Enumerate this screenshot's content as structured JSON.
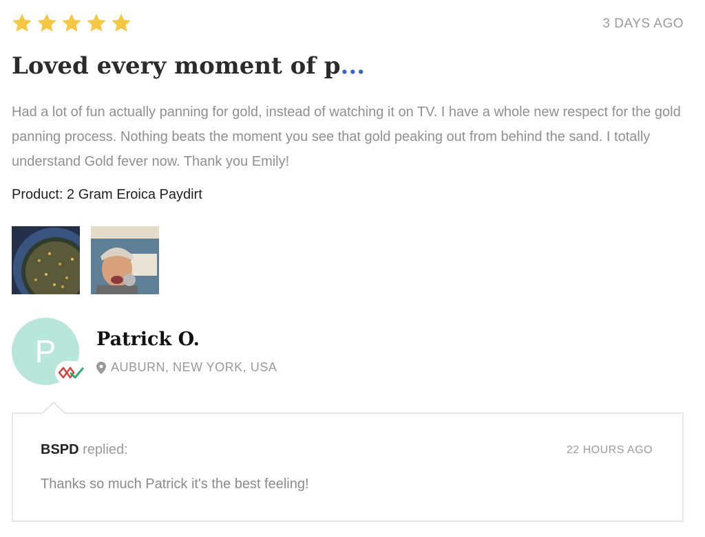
{
  "review": {
    "rating": 5,
    "max_rating": 5,
    "date": "3 DAYS AGO",
    "title": "Loved every moment of p",
    "title_ellipsis": "...",
    "body": "Had a lot of fun actually panning for gold, instead of watching it on TV. I have a whole new respect for the gold panning process. Nothing beats the moment you see that gold peaking out from behind the sand. I totally understand Gold fever now. Thank you Emily!",
    "product": "Product: 2 Gram Eroica Paydirt",
    "photo_count": 2
  },
  "reviewer": {
    "initial": "P",
    "name": "Patrick O.",
    "location": "AUBURN, NEW YORK, USA",
    "avatar_color": "#b8e6d9"
  },
  "reply": {
    "author": "BSPD",
    "verb": "replied:",
    "date": "22 HOURS AGO",
    "text": "Thanks so much Patrick it's the best feeling!"
  },
  "colors": {
    "star": "#f6c744",
    "accent": "#3b63c8",
    "verified_red": "#d7443e",
    "verified_green": "#2ea86a"
  },
  "icons": {
    "rating": "star-icon",
    "location": "map-pin-icon",
    "verified": "verified-buyer-icon"
  }
}
